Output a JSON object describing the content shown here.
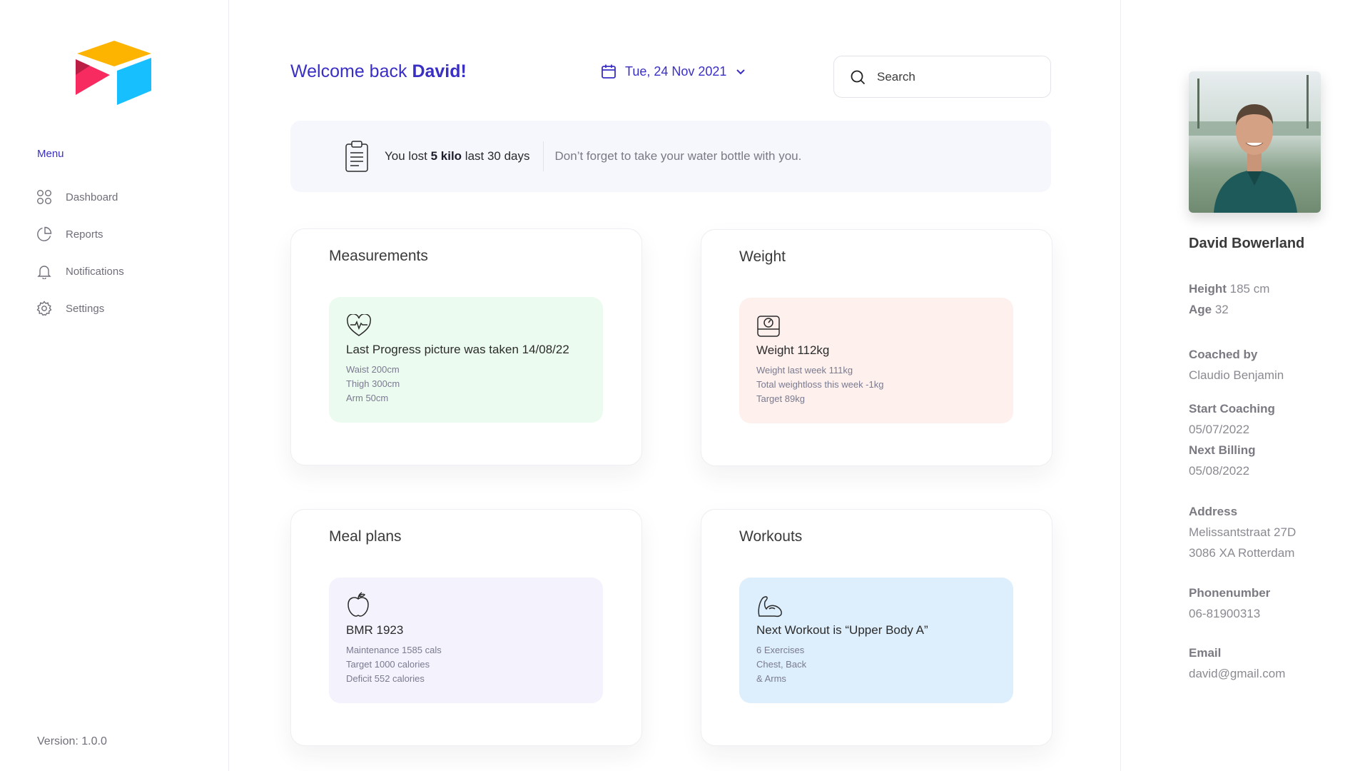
{
  "sidebar": {
    "menu_label": "Menu",
    "items": [
      {
        "label": "Dashboard",
        "icon": "grid-icon"
      },
      {
        "label": "Reports",
        "icon": "pie-chart-icon"
      },
      {
        "label": "Notifications",
        "icon": "bell-icon"
      },
      {
        "label": "Settings",
        "icon": "gear-icon"
      }
    ],
    "version": "Version: 1.0.0"
  },
  "header": {
    "welcome_prefix": "Welcome back ",
    "welcome_name": "David!",
    "date": "Tue, 24 Nov 2021",
    "search_placeholder": "Search"
  },
  "banner": {
    "lost_prefix": "You lost ",
    "lost_amount": "5 kilo",
    "lost_suffix": " last 30 days",
    "tip": "Don’t forget to take your water bottle with you."
  },
  "cards": {
    "measurements": {
      "title": "Measurements",
      "headline": "Last Progress picture was taken 14/08/22",
      "lines": [
        "Waist 200cm",
        "Thigh 300cm",
        "Arm 50cm"
      ]
    },
    "weight": {
      "title": "Weight",
      "headline": "Weight 112kg",
      "lines": [
        "Weight last week 111kg",
        "Total weightloss this week -1kg",
        "Target 89kg"
      ]
    },
    "meal_plans": {
      "title": "Meal plans",
      "headline": "BMR 1923",
      "lines": [
        "Maintenance 1585 cals",
        "Target 1000 calories",
        "Deficit 552 calories"
      ]
    },
    "workouts": {
      "title": "Workouts",
      "headline": "Next Workout  is “Upper Body A”",
      "lines": [
        "6 Exercises",
        "Chest, Back",
        "& Arms"
      ]
    }
  },
  "profile": {
    "name": "David Bowerland",
    "height_label": "Height",
    "height_value": " 185 cm",
    "age_label": "Age",
    "age_value": " 32",
    "coached_label": "Coached by",
    "coached_value": "Claudio Benjamin",
    "start_label": "Start Coaching",
    "start_value": "05/07/2022",
    "billing_label": "Next Billing",
    "billing_value": "05/08/2022",
    "address_label": "Address",
    "address_line1": "Melissantstraat 27D",
    "address_line2": "3086 XA Rotterdam",
    "phone_label": "Phonenumber",
    "phone_value": "06-81900313",
    "email_label": "Email",
    "email_value": "david@gmail.com"
  },
  "colors": {
    "accent": "#3a2fc4",
    "card_green": "#ecfbef",
    "card_peach": "#fdf0ed",
    "card_lavender": "#f3f2fd",
    "card_blue": "#ddeefc"
  }
}
